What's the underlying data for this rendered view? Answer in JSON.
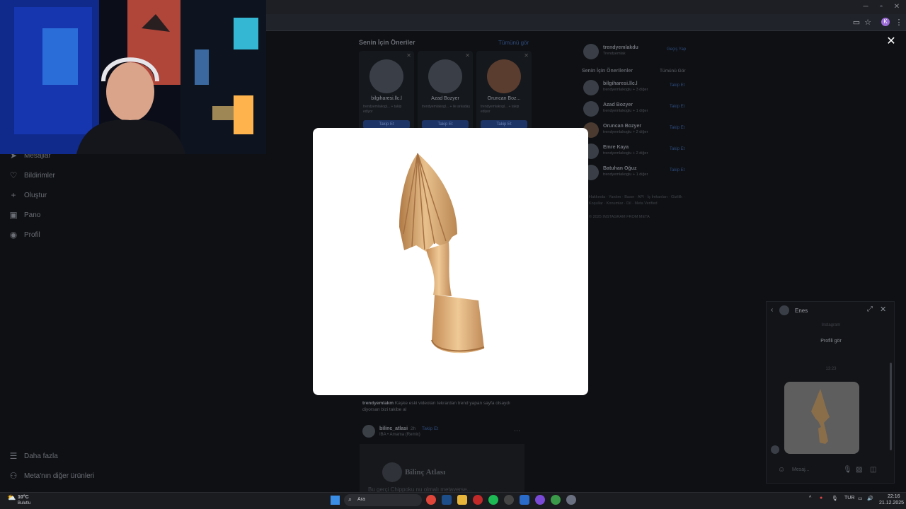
{
  "browser": {
    "profile_letter": "K"
  },
  "sidebar": {
    "items": [
      {
        "label": "Mesajlar",
        "icon": "send-icon"
      },
      {
        "label": "Bildirimler",
        "icon": "heart-icon"
      },
      {
        "label": "Oluştur",
        "icon": "plus-icon"
      },
      {
        "label": "Pano",
        "icon": "dashboard-icon"
      },
      {
        "label": "Profil",
        "icon": "avatar-icon"
      }
    ],
    "more_label": "Daha fazla",
    "meta_label": "Meta'nın diğer ürünleri"
  },
  "feed": {
    "suggestions_title": "Senin İçin Öneriler",
    "see_all": "Tümünü gör",
    "cards": [
      {
        "name": "bilgiharesi.llc.l",
        "sub": "trendyemlakogl... + takip ediyor",
        "button": "Takip Et"
      },
      {
        "name": "Azad Bozyer",
        "sub": "trendyemlakogl... + ile arkadaş",
        "button": "Takip Et"
      },
      {
        "name": "Oruncan Boz...",
        "sub": "trendyemlakogl... + takip ediyor",
        "button": "Takip Et"
      }
    ],
    "caption_user": "trendyemlakm",
    "caption_text": "Kaşke eski videoları tekrardan trend yapan sayfa olsaydı diyorsan bizi takibe al",
    "post_user": "bilinc_atlasi",
    "post_time": "2h",
    "post_follow": "Takip Et",
    "post_audio": "IBA • Amama (Remix)",
    "post_banner_title": "Bilinç Atlası",
    "post_banner_text": "Bu gerçi Chippoku nu olmalı metaverse..."
  },
  "right_sidebar": {
    "account_name": "trendyemlakdu",
    "account_sub": "Trendyemlak",
    "switch_label": "Geçiş Yap",
    "suggestions_title": "Senin İçin Önerilenler",
    "see_all": "Tümünü Gör",
    "rows": [
      {
        "name": "bilgiharesi.llc.l",
        "sub": "trendyemlakoglu + 3 diğer",
        "follow": "Takip Et"
      },
      {
        "name": "Azad Bozyer",
        "sub": "trendyemlakoglu + 1 diğer",
        "follow": "Takip Et"
      },
      {
        "name": "Oruncan Bozyer",
        "sub": "trendyemlakoglu + 2 diğer",
        "follow": "Takip Et"
      },
      {
        "name": "Emre Kaya",
        "sub": "trendyemlakoglu + 2 diğer",
        "follow": "Takip Et"
      },
      {
        "name": "Batuhan Oğuz",
        "sub": "trendyemlakoglu + 1 diğer",
        "follow": "Takip Et"
      }
    ],
    "footer": "Hakkında · Yardım · Basın · API · İş İmkanları · Gizlilik · Koşullar · Konumlar · Dil · Meta Verified",
    "copyright": "© 2025 INSTAGRAM FROM META"
  },
  "chat": {
    "name": "Enes",
    "meta": "Instagram",
    "profile_button": "Profili gör",
    "time": "13:23",
    "placeholder": "Mesaj..."
  },
  "taskbar": {
    "weather_temp": "10°C",
    "weather_desc": "Bulutlu",
    "search_label": "Ara",
    "lang": "TUR",
    "time": "22:16",
    "date": "21.12.2025"
  }
}
